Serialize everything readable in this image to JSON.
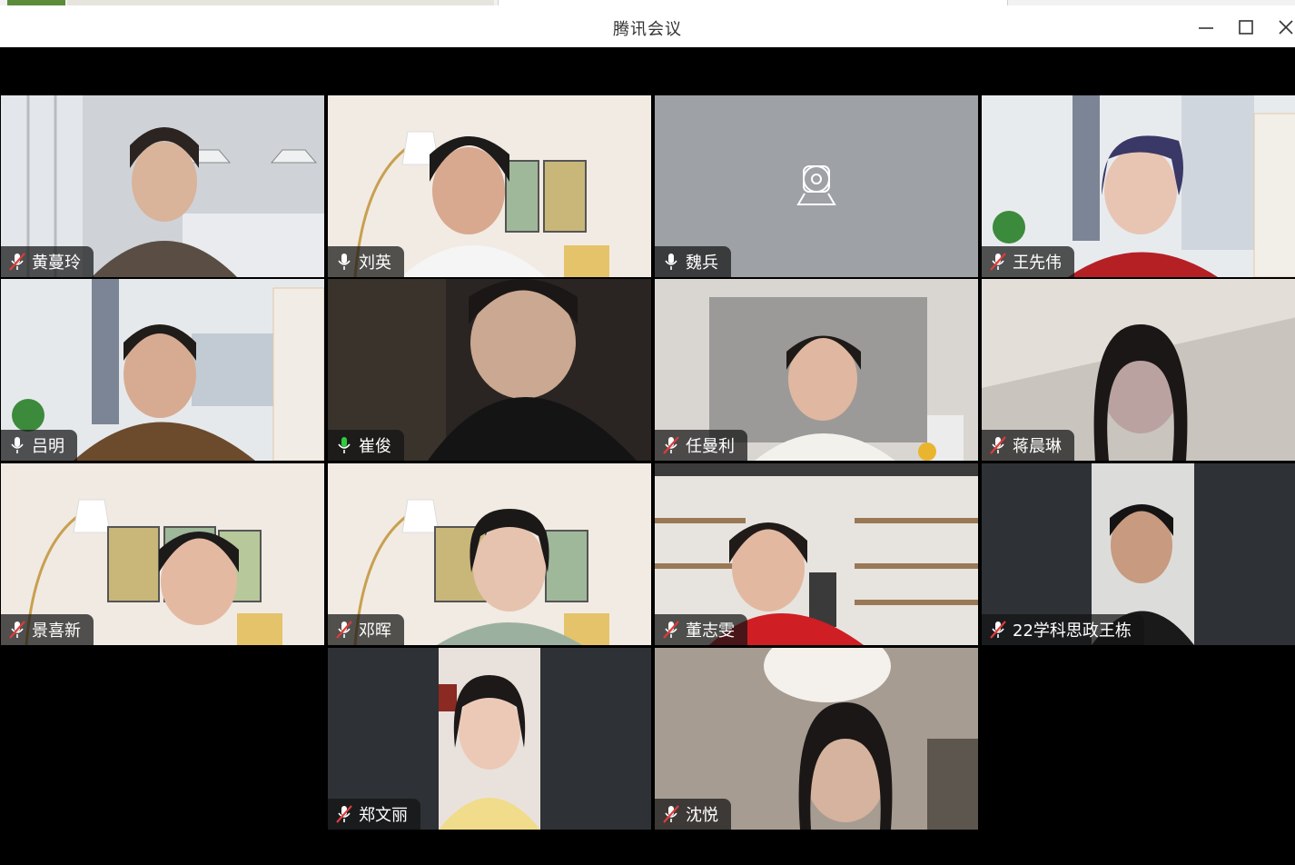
{
  "window": {
    "title": "腾讯会议"
  },
  "participants": [
    {
      "name": "黄蔓玲",
      "mic": "muted"
    },
    {
      "name": "刘英",
      "mic": "on"
    },
    {
      "name": "魏兵",
      "mic": "on"
    },
    {
      "name": "王先伟",
      "mic": "muted"
    },
    {
      "name": "吕明",
      "mic": "on"
    },
    {
      "name": "崔俊",
      "mic": "speaking"
    },
    {
      "name": "任曼利",
      "mic": "muted"
    },
    {
      "name": "蒋晨琳",
      "mic": "muted"
    },
    {
      "name": "景喜新",
      "mic": "muted"
    },
    {
      "name": "邓晖",
      "mic": "muted"
    },
    {
      "name": "董志雯",
      "mic": "muted"
    },
    {
      "name": "22学科思政王栋",
      "mic": "muted"
    },
    {
      "name": "郑文丽",
      "mic": "muted"
    },
    {
      "name": "沈悦",
      "mic": "muted"
    }
  ],
  "colors": {
    "active_speaker": "#1fbf5a",
    "mic_speaking": "#2ecc40"
  }
}
